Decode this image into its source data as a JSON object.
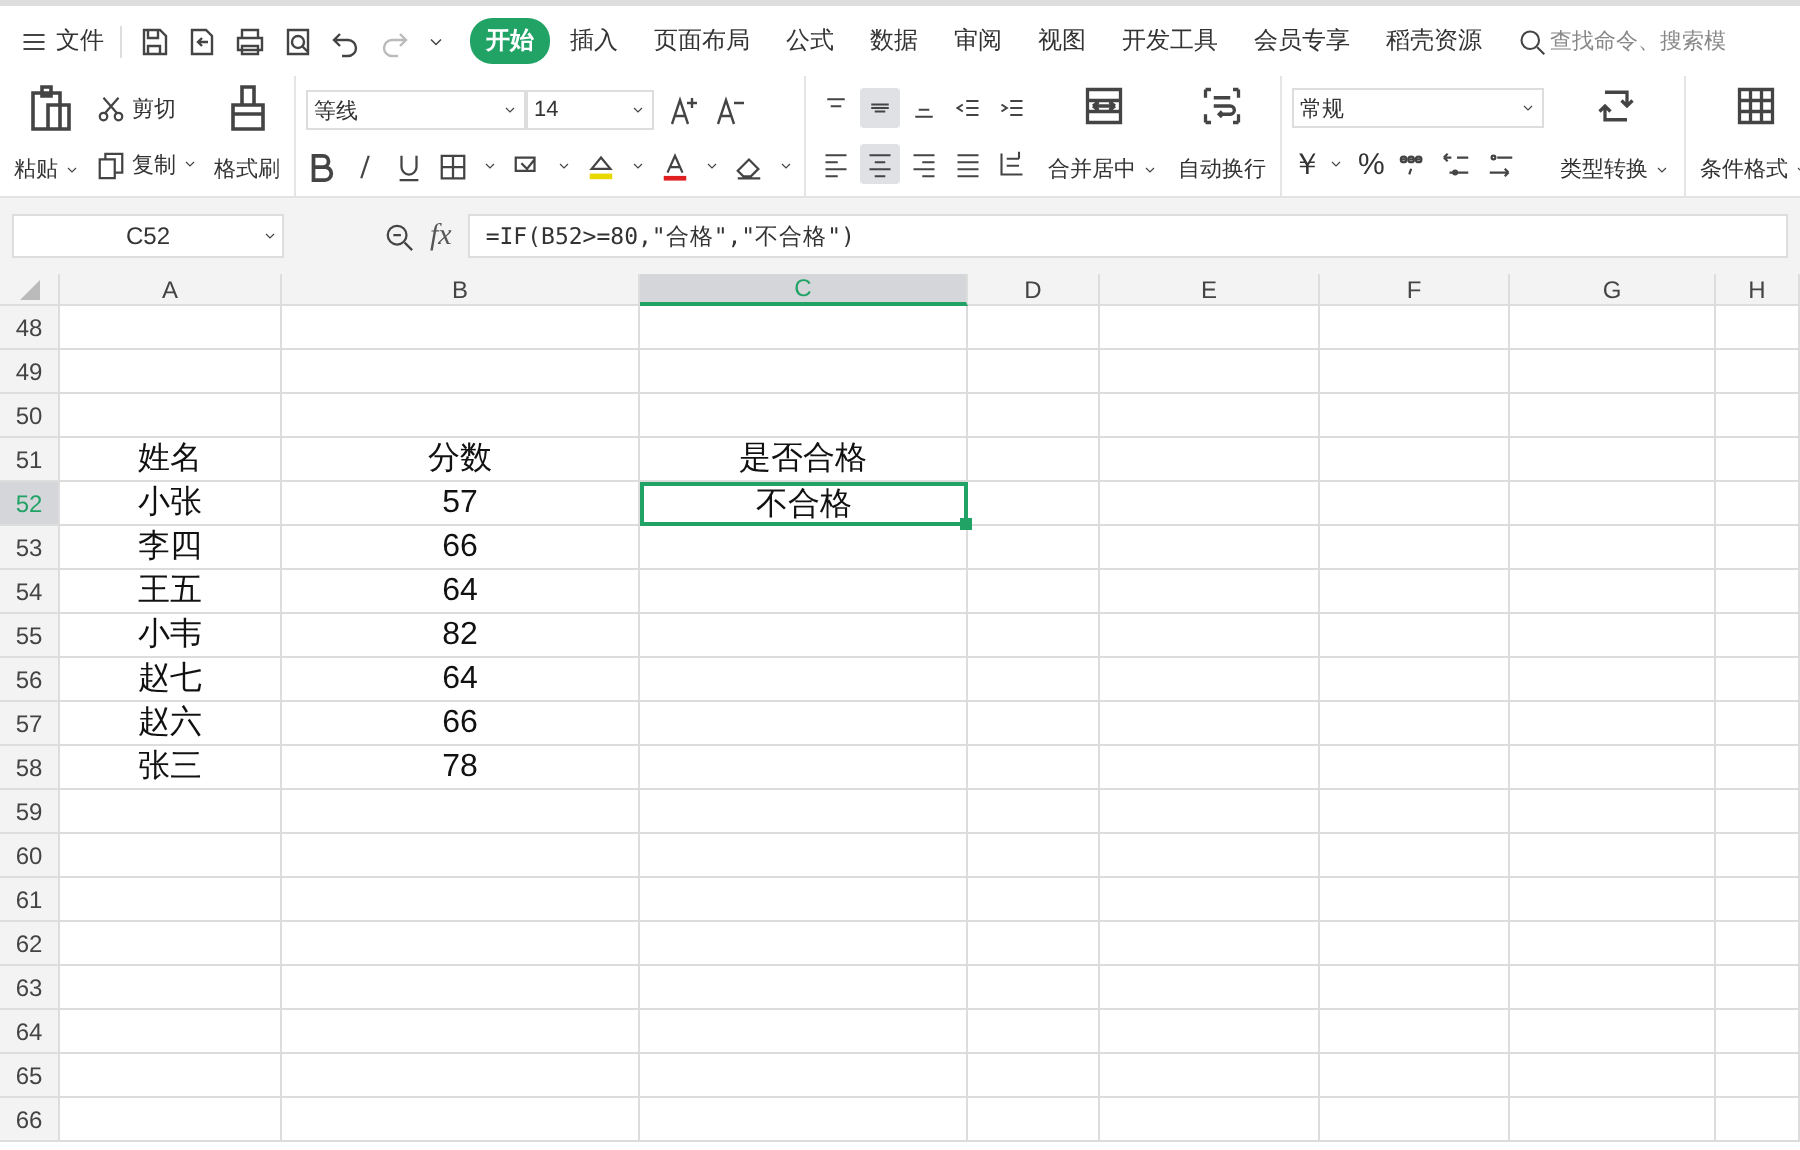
{
  "menu": {
    "file": "文件"
  },
  "tabs": [
    {
      "label": "开始",
      "selected": true
    },
    {
      "label": "插入",
      "selected": false
    },
    {
      "label": "页面布局",
      "selected": false
    },
    {
      "label": "公式",
      "selected": false
    },
    {
      "label": "数据",
      "selected": false
    },
    {
      "label": "审阅",
      "selected": false
    },
    {
      "label": "视图",
      "selected": false
    },
    {
      "label": "开发工具",
      "selected": false
    },
    {
      "label": "会员专享",
      "selected": false
    },
    {
      "label": "稻壳资源",
      "selected": false
    }
  ],
  "search": {
    "placeholder": "查找命令、搜索模"
  },
  "ribbon": {
    "paste": "粘贴",
    "cut": "剪切",
    "copy": "复制",
    "format_painter": "格式刷",
    "font": "等线",
    "font_size": "14",
    "align_buttons": [
      {
        "selected": false
      },
      {
        "selected": true
      },
      {
        "selected": false
      },
      {
        "selected": false
      },
      {
        "selected": false
      },
      {
        "selected": false
      },
      {
        "selected": true
      },
      {
        "selected": false
      },
      {
        "selected": false
      },
      {
        "selected": false
      }
    ],
    "merge": "合并居中",
    "wrap": "自动换行",
    "number_format": "常规",
    "currency": "￥",
    "percent": "%",
    "convert": "类型转换",
    "conditional": "条件格式"
  },
  "formula_bar": {
    "name_box": "C52",
    "function_label": "fx",
    "formula": "=IF(B52>=80,\"合格\",\"不合格\")"
  },
  "sheet": {
    "columns": [
      {
        "label": "A",
        "selected": false
      },
      {
        "label": "B",
        "selected": false
      },
      {
        "label": "C",
        "selected": true
      },
      {
        "label": "D",
        "selected": false
      },
      {
        "label": "E",
        "selected": false
      },
      {
        "label": "F",
        "selected": false
      },
      {
        "label": "G",
        "selected": false
      },
      {
        "label": "H",
        "selected": false
      }
    ],
    "rows": [
      {
        "number": "48",
        "selected": false,
        "cells": [
          "",
          "",
          ""
        ]
      },
      {
        "number": "49",
        "selected": false,
        "cells": [
          "",
          "",
          ""
        ]
      },
      {
        "number": "50",
        "selected": false,
        "cells": [
          "",
          "",
          ""
        ]
      },
      {
        "number": "51",
        "selected": false,
        "cells": [
          "姓名",
          "分数",
          "是否合格"
        ]
      },
      {
        "number": "52",
        "selected": true,
        "cells": [
          "小张",
          "57",
          "不合格"
        ]
      },
      {
        "number": "53",
        "selected": false,
        "cells": [
          "李四",
          "66",
          ""
        ]
      },
      {
        "number": "54",
        "selected": false,
        "cells": [
          "王五",
          "64",
          ""
        ]
      },
      {
        "number": "55",
        "selected": false,
        "cells": [
          "小韦",
          "82",
          ""
        ]
      },
      {
        "number": "56",
        "selected": false,
        "cells": [
          "赵七",
          "64",
          ""
        ]
      },
      {
        "number": "57",
        "selected": false,
        "cells": [
          "赵六",
          "66",
          ""
        ]
      },
      {
        "number": "58",
        "selected": false,
        "cells": [
          "张三",
          "78",
          ""
        ]
      },
      {
        "number": "59",
        "selected": false,
        "cells": [
          "",
          "",
          ""
        ]
      },
      {
        "number": "60",
        "selected": false,
        "cells": [
          "",
          "",
          ""
        ]
      },
      {
        "number": "61",
        "selected": false,
        "cells": [
          "",
          "",
          ""
        ]
      },
      {
        "number": "62",
        "selected": false,
        "cells": [
          "",
          "",
          ""
        ]
      },
      {
        "number": "63",
        "selected": false,
        "cells": [
          "",
          "",
          ""
        ]
      },
      {
        "number": "64",
        "selected": false,
        "cells": [
          "",
          "",
          ""
        ]
      },
      {
        "number": "65",
        "selected": false,
        "cells": [
          "",
          "",
          ""
        ]
      },
      {
        "number": "66",
        "selected": false,
        "cells": [
          "",
          "",
          ""
        ]
      }
    ]
  }
}
